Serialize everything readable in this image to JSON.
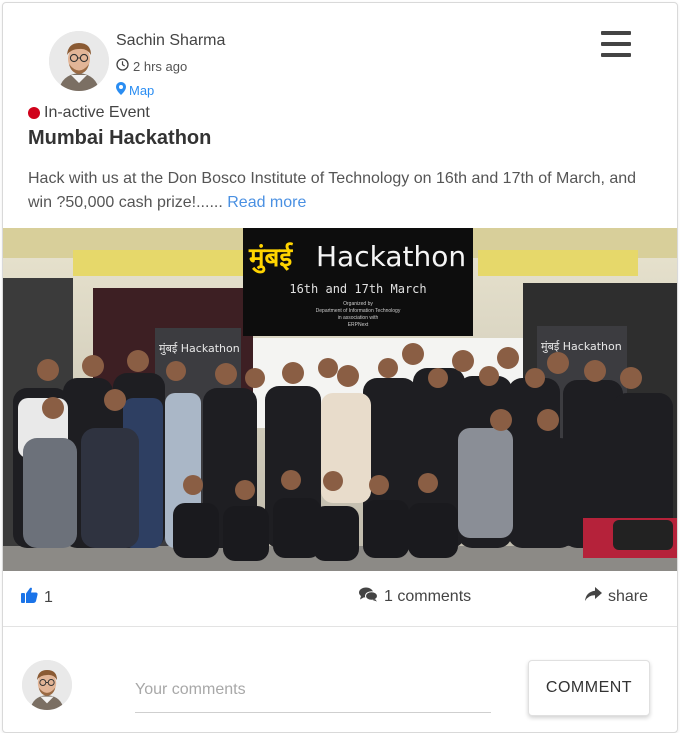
{
  "post": {
    "author_name": "Sachin Sharma",
    "time_ago": "2 hrs ago",
    "map_label": "Map",
    "status_label": "In-active Event",
    "title": "Mumbai Hackathon",
    "description": "Hack with us at the Don Bosco Institute of Technology on 16th and 17th of March, and win ?50,000 cash prize!......",
    "read_more": "Read more"
  },
  "banner": {
    "title_devanagari": "मुंबई",
    "title_latin": "Hackathon",
    "dates": "16th and 17th March",
    "organizer_line1": "Organized by",
    "organizer_line2": "Department of Information Technology",
    "organizer_line3": "in association with",
    "organizer_line4": "ERPNext",
    "standee_left": "मुंबई Hackathon",
    "standee_right": "मुंबई Hackathon"
  },
  "actions": {
    "like_count": "1",
    "comments_label": "1 comments",
    "share_label": "share"
  },
  "composer": {
    "placeholder": "Your comments",
    "button_label": "COMMENT"
  },
  "icons": {
    "like": "thumbs-up-icon",
    "comments": "comments-icon",
    "share": "share-icon",
    "clock": "clock-icon",
    "map": "map-marker-icon",
    "menu": "menu-icon"
  },
  "colors": {
    "status_inactive": "#d0021b",
    "link": "#4a90e2",
    "like": "#1a73e8",
    "banner_yellow": "#ffd400"
  }
}
